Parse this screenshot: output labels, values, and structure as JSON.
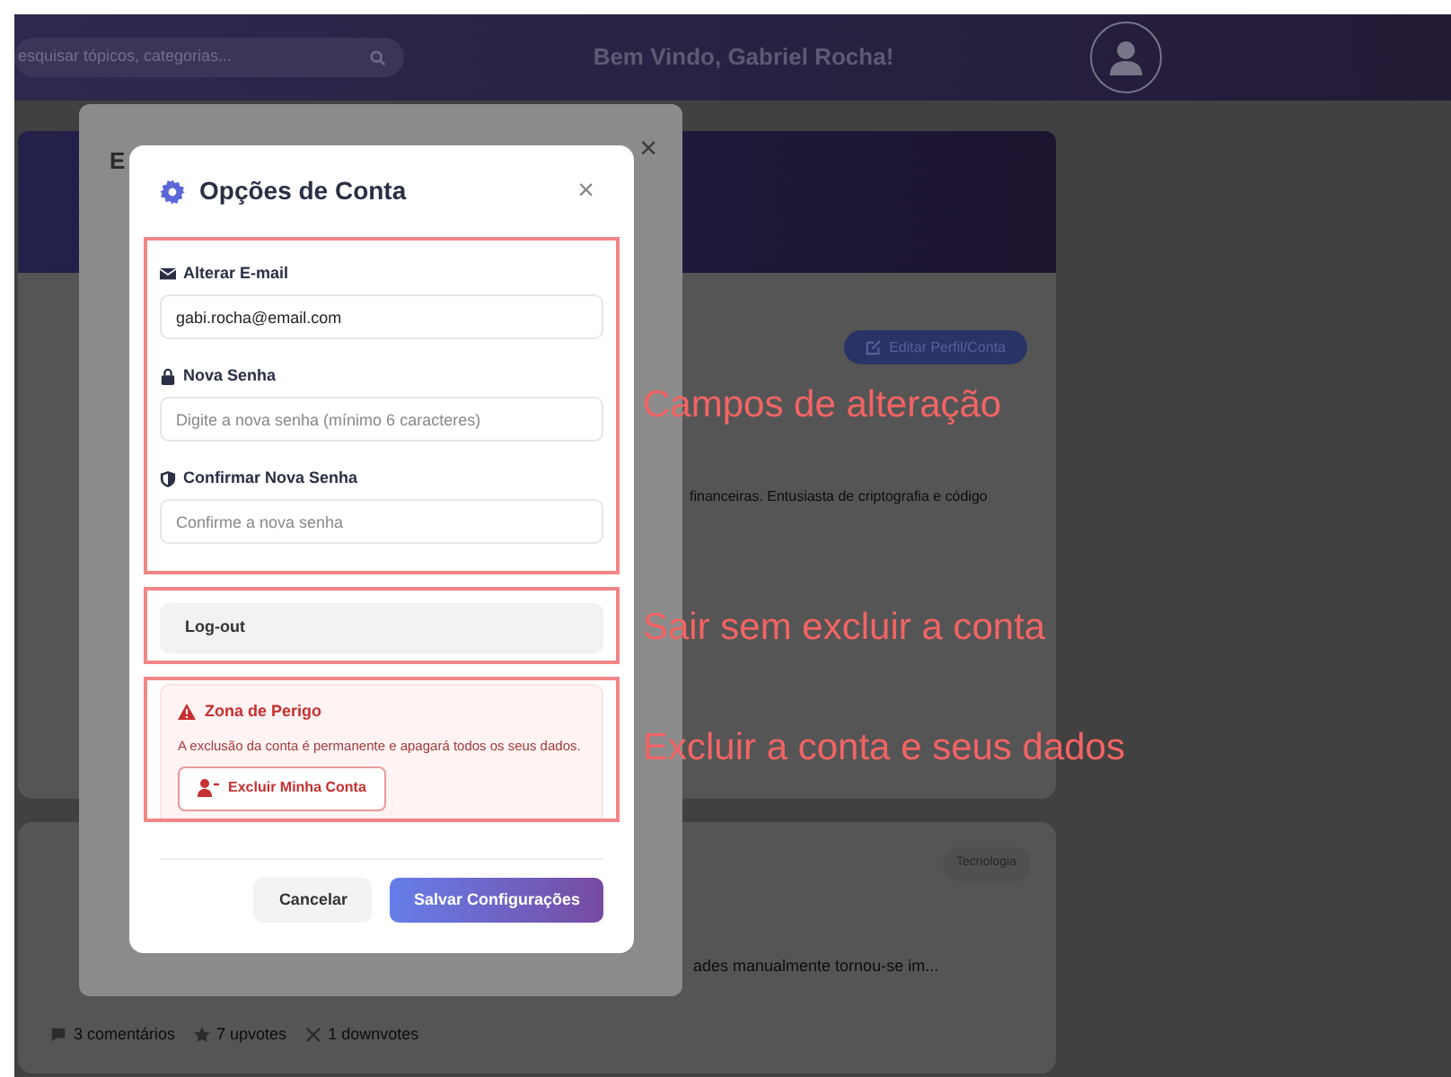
{
  "header": {
    "search_placeholder": "esquisar tópicos, categorias...",
    "greeting": "Bem Vindo, Gabriel Rocha!"
  },
  "profile": {
    "edit_button": "Editar Perfil/Conta",
    "bio": "financeiras. Entusiasta de criptografia e código"
  },
  "post": {
    "tag": "Tecnologia",
    "excerpt": "ades manualmente tornou-se im...",
    "stats": [
      {
        "kind": "comments",
        "label": "3 comentários"
      },
      {
        "kind": "upvotes",
        "label": "7 upvotes"
      },
      {
        "kind": "downvotes",
        "label": "1 downvotes"
      }
    ]
  },
  "edit_modal": {
    "title": "E",
    "close": "×"
  },
  "account_modal": {
    "title": "Opções de Conta",
    "close": "×",
    "fields": [
      {
        "kind": "email",
        "label": "Alterar E-mail",
        "value": "gabi.rocha@email.com"
      },
      {
        "kind": "lock",
        "label": "Nova Senha",
        "placeholder": "Digite a nova senha (mínimo 6 caracteres)"
      },
      {
        "kind": "shield",
        "label": "Confirmar Nova Senha",
        "placeholder": "Confirme a nova senha"
      }
    ],
    "logout_button": "Log-out",
    "danger_zone": {
      "title": "Zona de Perigo",
      "text": "A exclusão da conta é permanente e apagará todos os seus dados.",
      "button": "Excluir Minha Conta"
    },
    "buttons": [
      {
        "kind": "secondary",
        "label": "Cancelar"
      },
      {
        "kind": "primary",
        "label": "Salvar Configurações"
      }
    ]
  },
  "annotations": [
    "Campos de alteração",
    "Sair sem excluir a conta",
    "Excluir a conta e seus dados"
  ]
}
